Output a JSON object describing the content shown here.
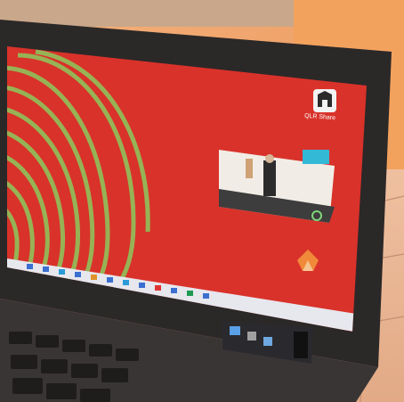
{
  "scene": {
    "description_free": true,
    "colors": {
      "wallpaper": "#d9322a",
      "fingerprint": "#8fc15a",
      "bezel": "#2a2727",
      "wall": "#f0a46a",
      "tile": "#e6b08f"
    }
  },
  "desktop": {
    "icons": [
      {
        "icon": "qr-share-icon",
        "label": "QLR Share"
      },
      {
        "icon": "video-thumbnail-icon",
        "label": ""
      },
      {
        "icon": "orange-logo-icon",
        "label": ""
      }
    ]
  }
}
